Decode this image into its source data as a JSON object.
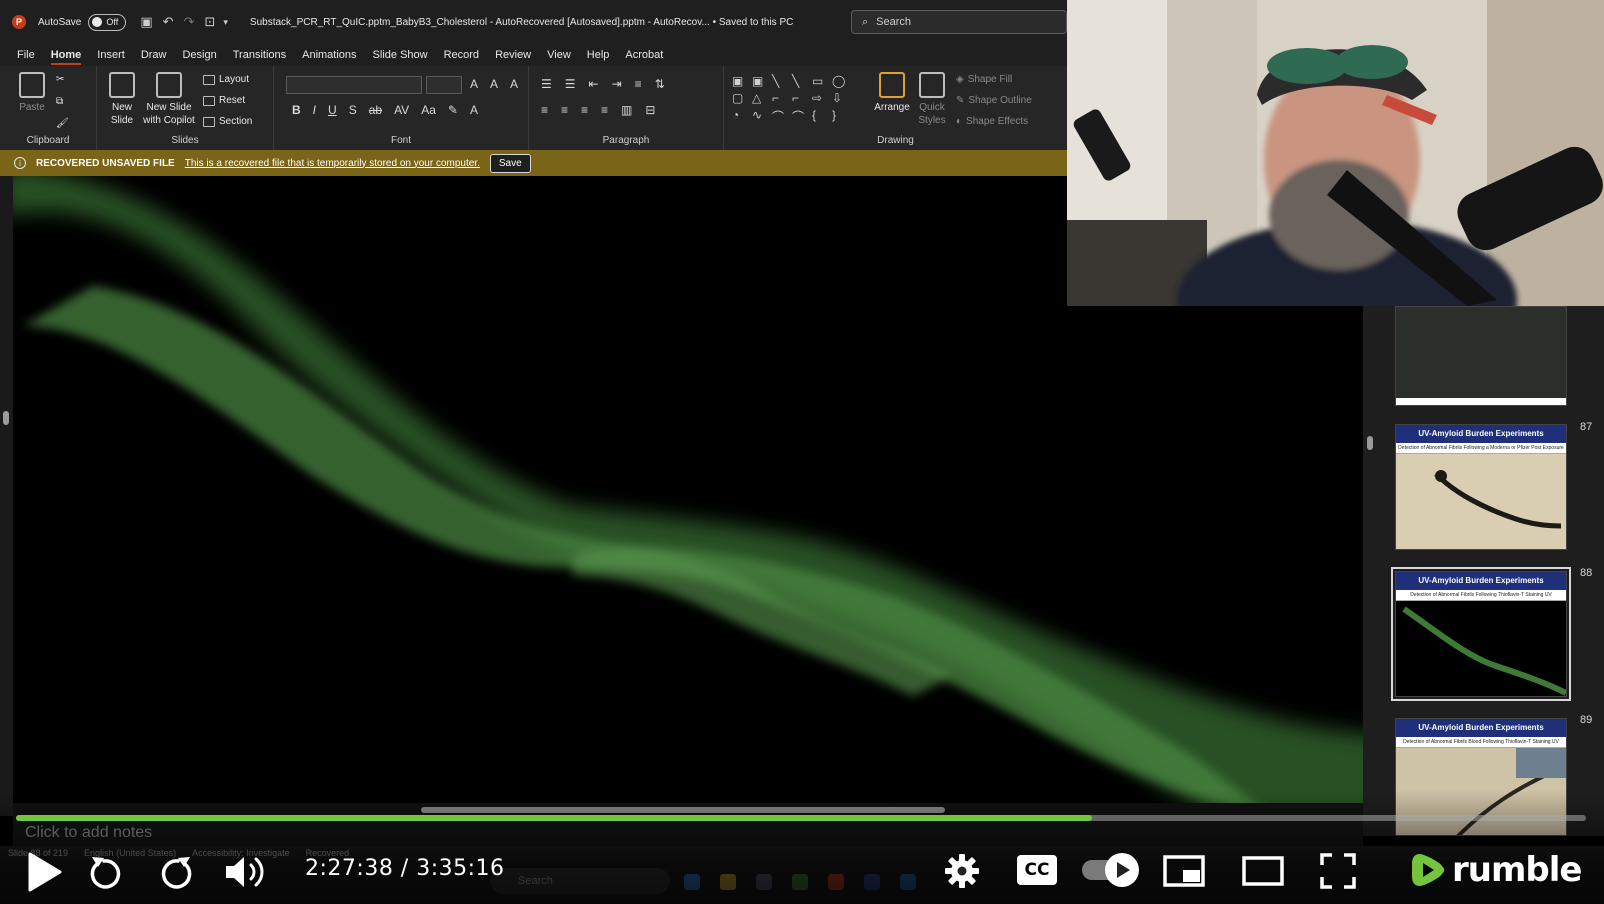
{
  "titlebar": {
    "autosave_label": "AutoSave",
    "autosave_state": "Off",
    "document_title": "Substack_PCR_RT_QuIC.pptm_BabyB3_Cholesterol  -  AutoRecovered [Autosaved].pptm  -  AutoRecov...  •  Saved to this PC",
    "search_placeholder": "Search"
  },
  "ribbon_tabs": [
    "File",
    "Home",
    "Insert",
    "Draw",
    "Design",
    "Transitions",
    "Animations",
    "Slide Show",
    "Record",
    "Review",
    "View",
    "Help",
    "Acrobat"
  ],
  "active_tab": "Home",
  "ribbon": {
    "clipboard": {
      "label": "Clipboard",
      "paste": "Paste"
    },
    "slides": {
      "label": "Slides",
      "new_slide": "New Slide",
      "new_slide_copilot_1": "New Slide",
      "new_slide_copilot_2": "with Copilot",
      "layout": "Layout",
      "reset": "Reset",
      "section": "Section"
    },
    "font": {
      "label": "Font"
    },
    "paragraph": {
      "label": "Paragraph"
    },
    "drawing": {
      "label": "Drawing",
      "arrange": "Arrange",
      "quick_styles_1": "Quick",
      "quick_styles_2": "Styles",
      "shape_fill": "Shape Fill",
      "shape_outline": "Shape Outline",
      "shape_effects": "Shape Effects"
    }
  },
  "recovered_bar": {
    "title": "RECOVERED UNSAVED FILE",
    "message": "This is a recovered file that is temporarily stored on your computer.",
    "save_button": "Save"
  },
  "thumbnails": [
    {
      "number": "87",
      "title": "UV-Amyloid Burden Experiments",
      "subtitle": "Detection of Abnormal Fibrils Following a Moderna or Pfizer Post Exposure",
      "selected": false
    },
    {
      "number": "88",
      "title": "UV-Amyloid Burden Experiments",
      "subtitle": "Detection of Abnormal Fibrils Following Thioflavin-T Staining UV",
      "selected": true
    },
    {
      "number": "89",
      "title": "UV-Amyloid Burden Experiments",
      "subtitle": "Detection of Abnormal Fibrils Blood Following Thioflavin-T Staining UV",
      "selected": false
    }
  ],
  "notes_placeholder": "Click to add notes",
  "statusbar": {
    "slide_info": "Slide 88 of 219",
    "language": "English (United States)",
    "accessibility": "Accessibility: Investigate",
    "recovered": "Recovered"
  },
  "taskbar": {
    "search_placeholder": "Search"
  },
  "player": {
    "current_time": "2:27:38",
    "separator": " / ",
    "duration": "3:35:16",
    "progress_fraction": 0.6856,
    "cc_label": "CC",
    "brand": "rumble",
    "accent_color": "#74c43e"
  }
}
